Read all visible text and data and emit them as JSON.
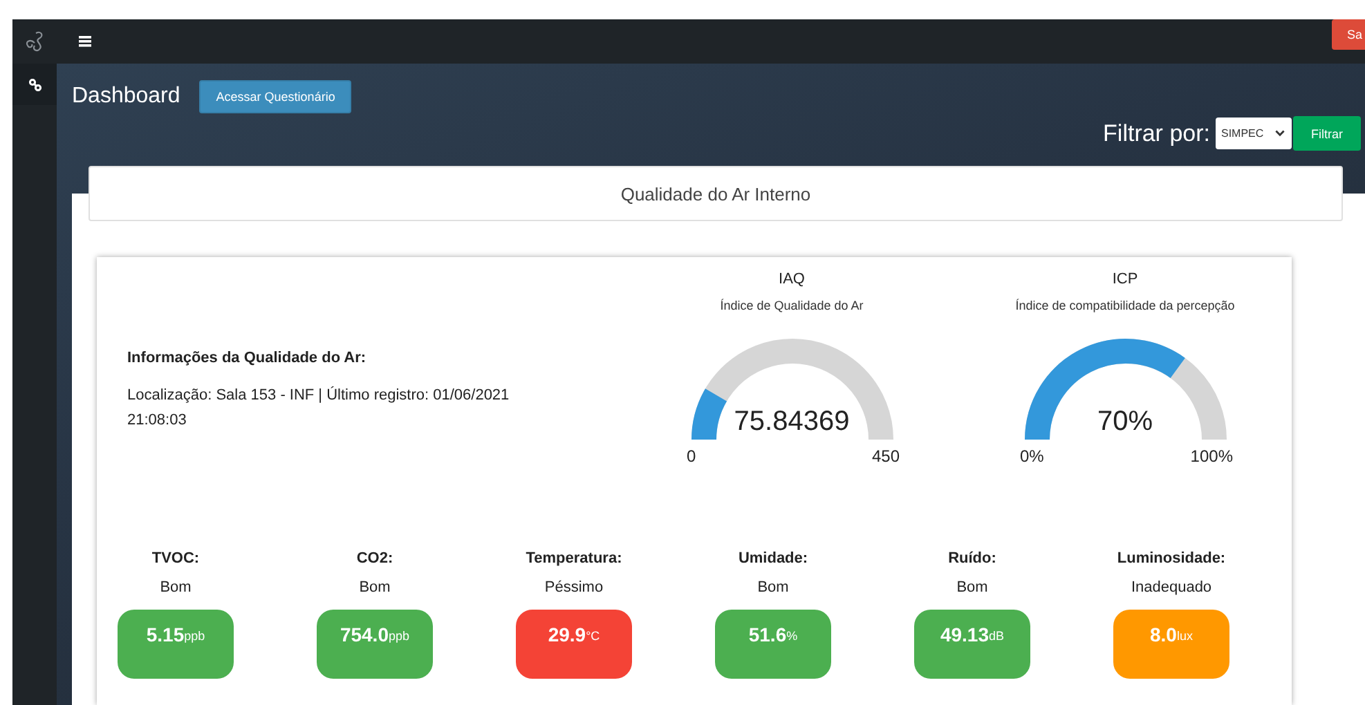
{
  "navbar": {
    "logout_button": "Sa"
  },
  "header": {
    "title": "Dashboard",
    "questionnaire_button": "Acessar Questionário"
  },
  "filter": {
    "label": "Filtrar por:",
    "select_value": "SIMPEC",
    "button": "Filtrar"
  },
  "panel": {
    "title": "Qualidade do Ar Interno"
  },
  "info": {
    "title": "Informações da Qualidade do Ar:",
    "text": "Localização: Sala 153 - INF | Último registro: 01/06/2021 21:08:03"
  },
  "gauges": [
    {
      "title": "IAQ",
      "subtitle": "Índice de Qualidade do Ar",
      "value": "75.84369",
      "min": "0",
      "max": "450"
    },
    {
      "title": "ICP",
      "subtitle": "Índice de compatibilidade da percepção",
      "value": "70%",
      "min": "0%",
      "max": "100%"
    }
  ],
  "metrics": [
    {
      "label": "TVOC:",
      "status": "Bom",
      "value": "5.15",
      "unit": "ppb",
      "color": "#4caf50"
    },
    {
      "label": "CO2:",
      "status": "Bom",
      "value": "754.0",
      "unit": "ppb",
      "color": "#4caf50"
    },
    {
      "label": "Temperatura:",
      "status": "Péssimo",
      "value": "29.9",
      "unit": "°C",
      "color": "#f44336"
    },
    {
      "label": "Umidade:",
      "status": "Bom",
      "value": "51.6",
      "unit": "%",
      "color": "#4caf50"
    },
    {
      "label": "Ruído:",
      "status": "Bom",
      "value": "49.13",
      "unit": "dB",
      "color": "#4caf50"
    },
    {
      "label": "Luminosidade:",
      "status": "Inadequado",
      "value": "8.0",
      "unit": "lux",
      "color": "#ff9800"
    }
  ]
}
